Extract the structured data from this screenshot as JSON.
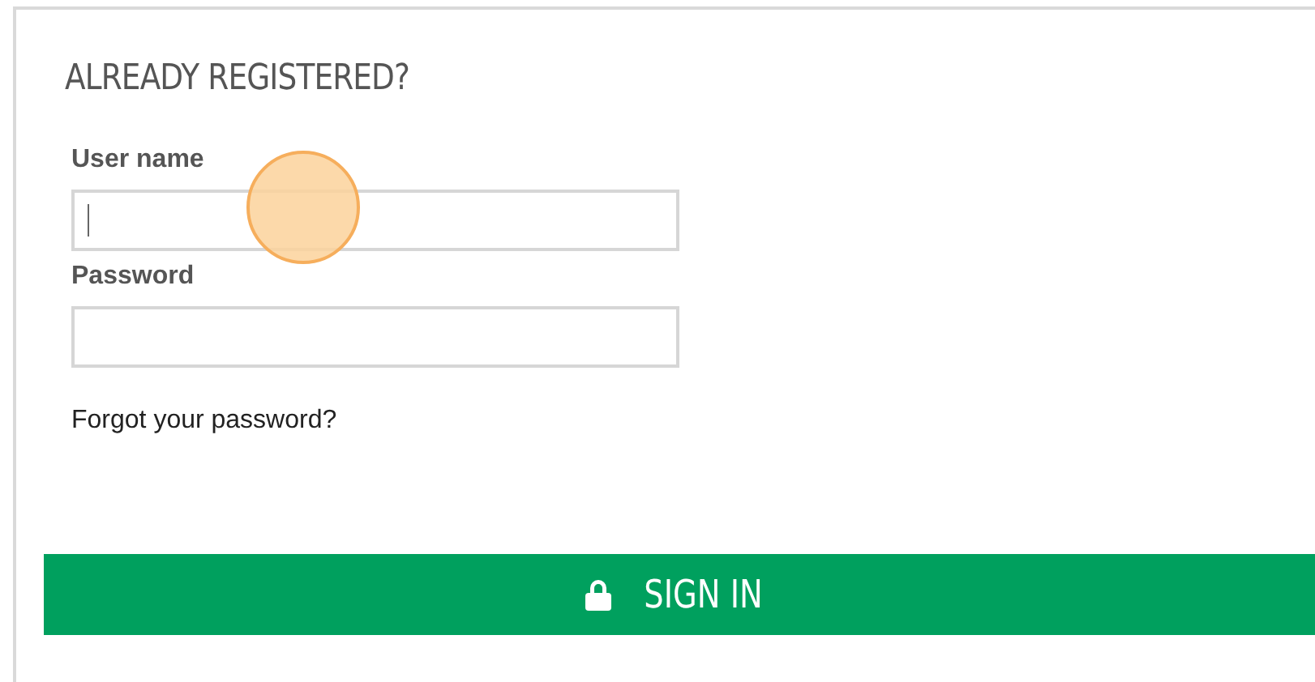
{
  "heading": "ALREADY REGISTERED?",
  "fields": [
    {
      "label": "User name",
      "focused": true
    },
    {
      "label": "Password",
      "focused": false
    }
  ],
  "forgot_link": "Forgot your password?",
  "sign_in_button": "SIGN IN"
}
